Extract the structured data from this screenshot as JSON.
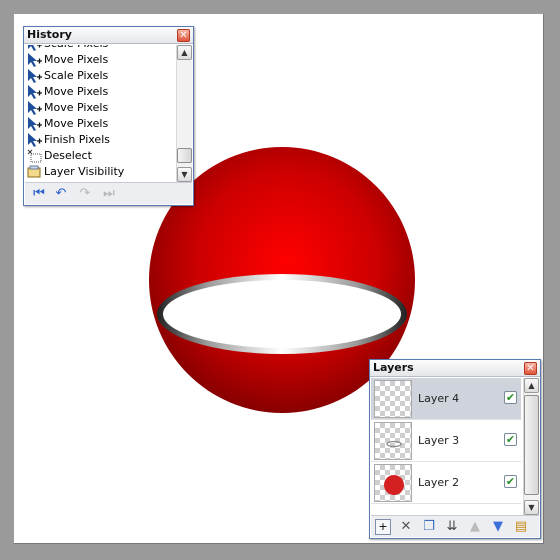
{
  "history": {
    "title": "History",
    "items": [
      {
        "label": "Scale Pixels",
        "icon": "scale-pixels-icon"
      },
      {
        "label": "Move Pixels",
        "icon": "move-pixels-icon"
      },
      {
        "label": "Scale Pixels",
        "icon": "scale-pixels-icon"
      },
      {
        "label": "Move Pixels",
        "icon": "move-pixels-icon"
      },
      {
        "label": "Move Pixels",
        "icon": "move-pixels-icon"
      },
      {
        "label": "Move Pixels",
        "icon": "move-pixels-icon"
      },
      {
        "label": "Finish Pixels",
        "icon": "finish-pixels-icon"
      },
      {
        "label": "Deselect",
        "icon": "deselect-icon"
      },
      {
        "label": "Layer Visibility",
        "icon": "layer-properties-icon"
      }
    ],
    "tools": [
      "rewind-icon",
      "undo-icon",
      "redo-icon",
      "fast-forward-icon"
    ]
  },
  "layers": {
    "title": "Layers",
    "items": [
      {
        "name": "Layer 4",
        "visible": true,
        "selected": true
      },
      {
        "name": "Layer 3",
        "visible": true,
        "selected": false
      },
      {
        "name": "Layer 2",
        "visible": true,
        "selected": false
      }
    ],
    "tools": [
      "add-layer-icon",
      "delete-layer-icon",
      "duplicate-layer-icon",
      "merge-layer-down-icon",
      "move-layer-up-icon",
      "move-layer-down-icon",
      "layer-properties-icon"
    ]
  },
  "colors": {
    "sphere": "#d40000",
    "sphere_dark": "#6e0000",
    "window_border": "#5a7ab0",
    "canvas": "#ffffff",
    "workspace": "#9a9a9a"
  }
}
